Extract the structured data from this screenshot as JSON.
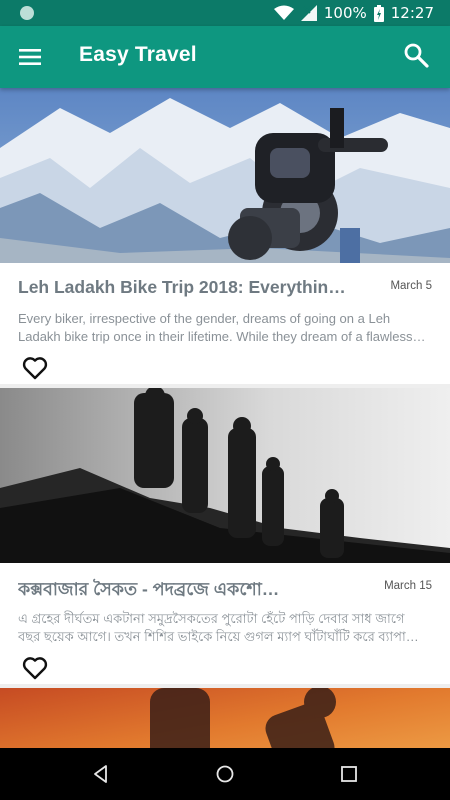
{
  "status_bar": {
    "battery": "100%",
    "time": "12:27",
    "icons": [
      "notification-dot-icon",
      "wifi-icon",
      "signal-icon",
      "battery-icon"
    ]
  },
  "app_bar": {
    "title": "Easy Travel",
    "icons": [
      "menu-icon",
      "search-icon"
    ]
  },
  "posts": [
    {
      "title": "Leh Ladakh Bike Trip 2018: Everythin…",
      "date": "March 5",
      "excerpt_lines": [
        "Every biker, irrespective of the gender, dreams of going on a Leh",
        "Ladakh bike trip once in their lifetime. While they dream of a flawless…"
      ],
      "image": "motorcycle-mountain-photo"
    },
    {
      "title": "কক্সবাজার সৈকত - পদব্রজে একশো…",
      "date": "March 15",
      "excerpt_lines": [
        "এ গ্রহের দীর্ঘতম একটানা সমুদ্রসৈকতের পুরোটা হেঁটে পাড়ি দেবার সাধ জাগে",
        "বছর ছয়েক আগে। তখন শিশির ভাইকে নিয়ে গুগল ম্যাপ ঘাঁটাঘাঁটি করে ব্যাপা…"
      ],
      "image": "hikers-silhouette-photo"
    },
    {
      "image": "sunset-silhouette-photo"
    }
  ],
  "colors": {
    "status_bar": "#0c7a68",
    "app_bar": "#0e9780",
    "title_text": "#6f7a82",
    "excerpt_text": "#8a9197"
  },
  "nav_bar": {
    "icons": [
      "back-icon",
      "home-icon",
      "recents-icon"
    ]
  }
}
